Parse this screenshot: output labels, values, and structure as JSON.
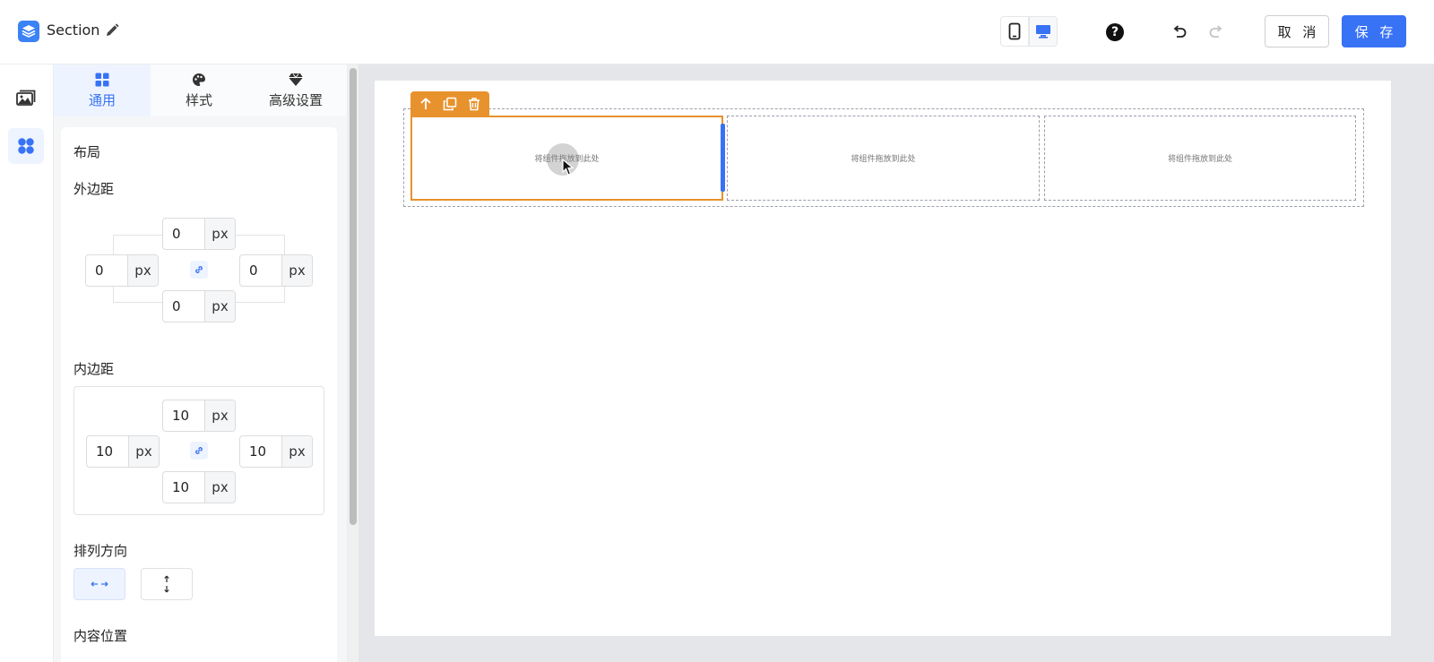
{
  "header": {
    "title": "Section",
    "cancel_label": "取 消",
    "save_label": "保 存",
    "help_glyph": "?"
  },
  "rail": {
    "items": [
      {
        "icon": "image-gallery-icon",
        "active": false
      },
      {
        "icon": "components-grid-icon",
        "active": true
      }
    ]
  },
  "tabs": [
    {
      "label": "通用",
      "icon": "grid-icon",
      "active": true
    },
    {
      "label": "样式",
      "icon": "palette-icon",
      "active": false
    },
    {
      "label": "高级设置",
      "icon": "diamond-icon",
      "active": false
    }
  ],
  "layout": {
    "heading": "布局",
    "margin": {
      "label": "外边距",
      "top": "0",
      "left": "0",
      "right": "0",
      "bottom": "0",
      "unit": "px"
    },
    "padding": {
      "label": "内边距",
      "top": "10",
      "left": "10",
      "right": "10",
      "bottom": "10",
      "unit": "px"
    },
    "direction": {
      "label": "排列方向",
      "options": [
        "horizontal",
        "vertical"
      ],
      "selected": "horizontal"
    },
    "content_position": {
      "label": "内容位置"
    }
  },
  "canvas": {
    "columns": [
      {
        "placeholder": "将组件拖放到此处",
        "selected": true
      },
      {
        "placeholder": "将组件拖放到此处",
        "selected": false
      },
      {
        "placeholder": "将组件拖放到此处",
        "selected": false
      }
    ],
    "toolbar": [
      "move-up-icon",
      "duplicate-icon",
      "delete-icon"
    ]
  },
  "colors": {
    "primary": "#3872f5",
    "selection": "#e8922d",
    "canvas_bg": "#e5e6e9"
  }
}
